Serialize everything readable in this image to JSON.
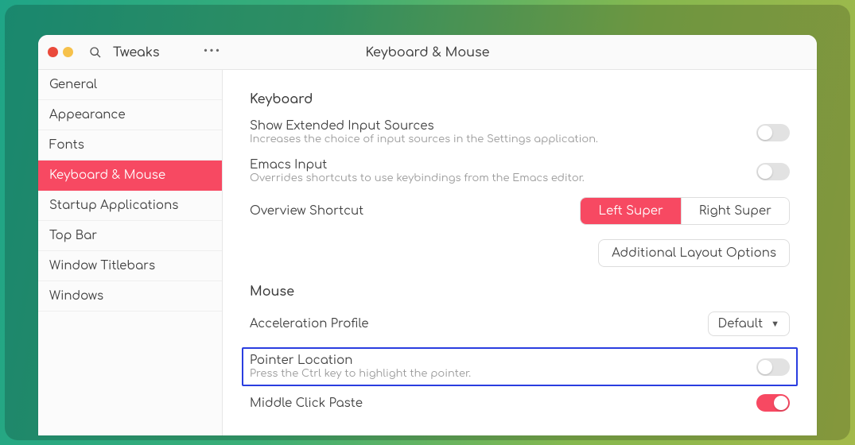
{
  "header": {
    "app_title": "Tweaks",
    "page_title": "Keyboard & Mouse"
  },
  "sidebar": {
    "items": [
      {
        "label": "General"
      },
      {
        "label": "Appearance"
      },
      {
        "label": "Fonts"
      },
      {
        "label": "Keyboard & Mouse"
      },
      {
        "label": "Startup Applications"
      },
      {
        "label": "Top Bar"
      },
      {
        "label": "Window Titlebars"
      },
      {
        "label": "Windows"
      }
    ],
    "active_index": 3
  },
  "keyboard": {
    "section_label": "Keyboard",
    "extended": {
      "title": "Show Extended Input Sources",
      "sub": "Increases the choice of input sources in the Settings application.",
      "on": false
    },
    "emacs": {
      "title": "Emacs Input",
      "sub": "Overrides shortcuts to use keybindings from the Emacs editor.",
      "on": false
    },
    "overview": {
      "title": "Overview Shortcut",
      "left": "Left Super",
      "right": "Right Super",
      "active": "left"
    },
    "layout_btn": "Additional Layout Options"
  },
  "mouse": {
    "section_label": "Mouse",
    "accel": {
      "title": "Acceleration Profile",
      "value": "Default"
    },
    "pointer": {
      "title": "Pointer Location",
      "sub": "Press the Ctrl key to highlight the pointer.",
      "on": false
    },
    "middle": {
      "title": "Middle Click Paste",
      "on": true
    }
  }
}
